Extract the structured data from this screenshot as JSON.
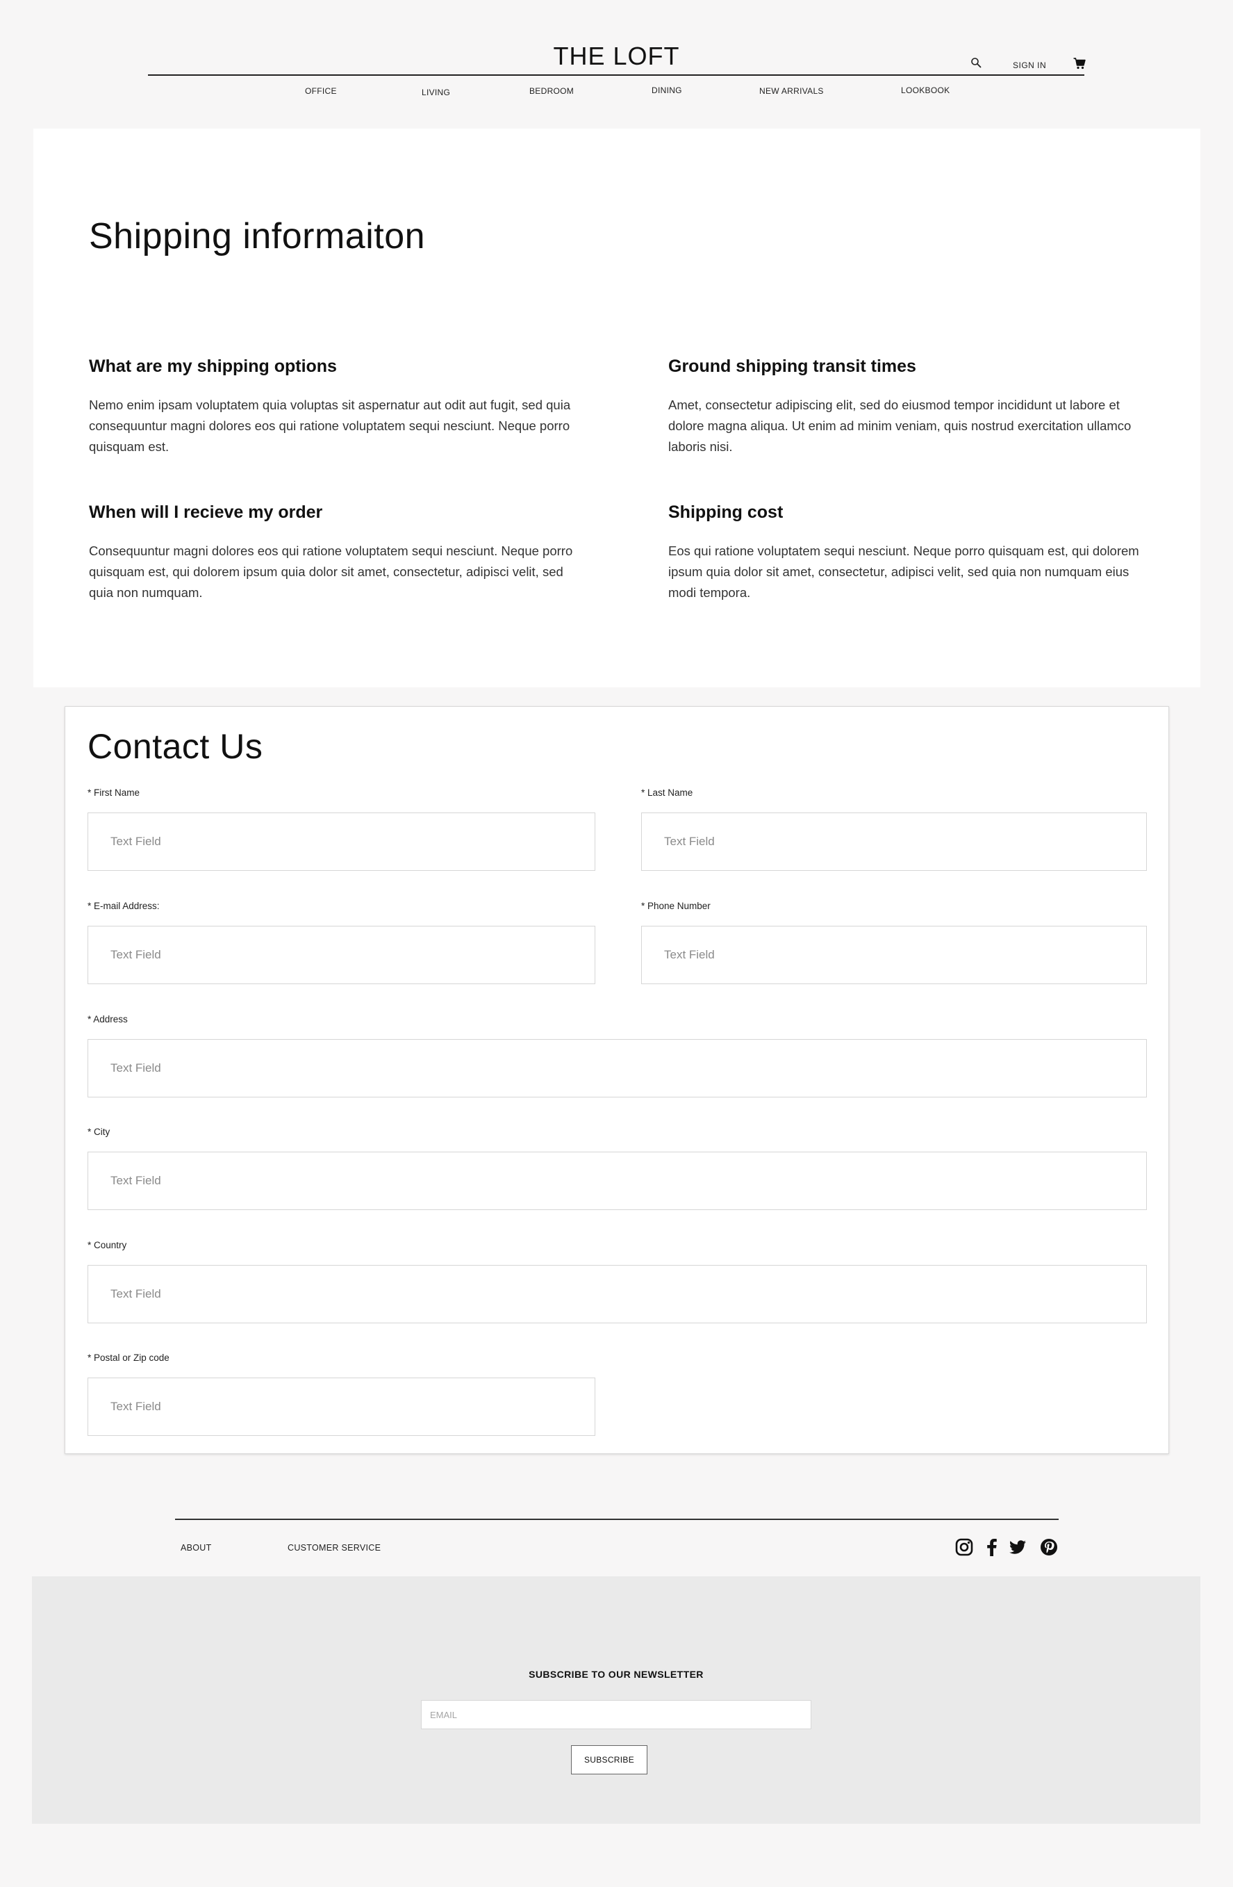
{
  "header": {
    "brand": "THE LOFT",
    "sign_in": "SIGN IN",
    "nav": [
      "OFFICE",
      "LIVING",
      "BEDROOM",
      "DINING",
      "NEW ARRIVALS",
      "LOOKBOOK"
    ]
  },
  "icons": {
    "search": "search-icon",
    "cart": "cart-icon",
    "social": [
      "instagram-icon",
      "facebook-icon",
      "twitter-icon",
      "pinterest-icon"
    ]
  },
  "shipping": {
    "title": "Shipping informaiton",
    "faqs": [
      {
        "question": "What are my shipping options",
        "answer": "Nemo enim ipsam voluptatem quia voluptas sit aspernatur aut odit aut fugit, sed quia consequuntur magni dolores eos qui ratione voluptatem sequi nesciunt. Neque porro quisquam est."
      },
      {
        "question": "Ground shipping transit times",
        "answer": "Amet, consectetur adipiscing elit, sed do eiusmod tempor incididunt ut labore et dolore magna aliqua. Ut enim ad minim veniam, quis nostrud exercitation ullamco laboris nisi."
      },
      {
        "question": "When will I recieve my order",
        "answer": "Consequuntur magni dolores eos qui ratione voluptatem sequi nesciunt. Neque porro quisquam est, qui dolorem ipsum quia dolor sit amet, consectetur, adipisci velit, sed quia non numquam."
      },
      {
        "question": "Shipping cost",
        "answer": "Eos qui ratione voluptatem sequi nesciunt. Neque porro quisquam est, qui dolorem ipsum quia dolor sit amet, consectetur, adipisci velit, sed quia non numquam eius modi tempora."
      }
    ]
  },
  "contact": {
    "title": "Contact Us",
    "fields": {
      "first_name": {
        "label": "* First Name",
        "placeholder": "Text Field",
        "value": ""
      },
      "last_name": {
        "label": "* Last Name",
        "placeholder": "Text Field",
        "value": ""
      },
      "email": {
        "label": "* E-mail Address:",
        "placeholder": "Text Field",
        "value": ""
      },
      "phone": {
        "label": "* Phone Number",
        "placeholder": "Text Field",
        "value": ""
      },
      "address": {
        "label": "* Address",
        "placeholder": "Text Field",
        "value": ""
      },
      "city": {
        "label": "* City",
        "placeholder": "Text Field",
        "value": ""
      },
      "country": {
        "label": "* Country",
        "placeholder": "Text Field",
        "value": ""
      },
      "postal": {
        "label": "* Postal or Zip code",
        "placeholder": "Text Field",
        "value": ""
      }
    }
  },
  "footer": {
    "links": [
      "ABOUT",
      "CUSTOMER SERVICE"
    ],
    "newsletter": {
      "title": "SUBSCRIBE TO OUR NEWSLETTER",
      "email_placeholder": "EMAIL",
      "subscribe_label": "SUBSCRIBE"
    }
  },
  "colors": {
    "page_background": "#f7f6f6",
    "panel_background": "#ffffff",
    "newsletter_background": "#eaeaea",
    "text": "#111111"
  }
}
